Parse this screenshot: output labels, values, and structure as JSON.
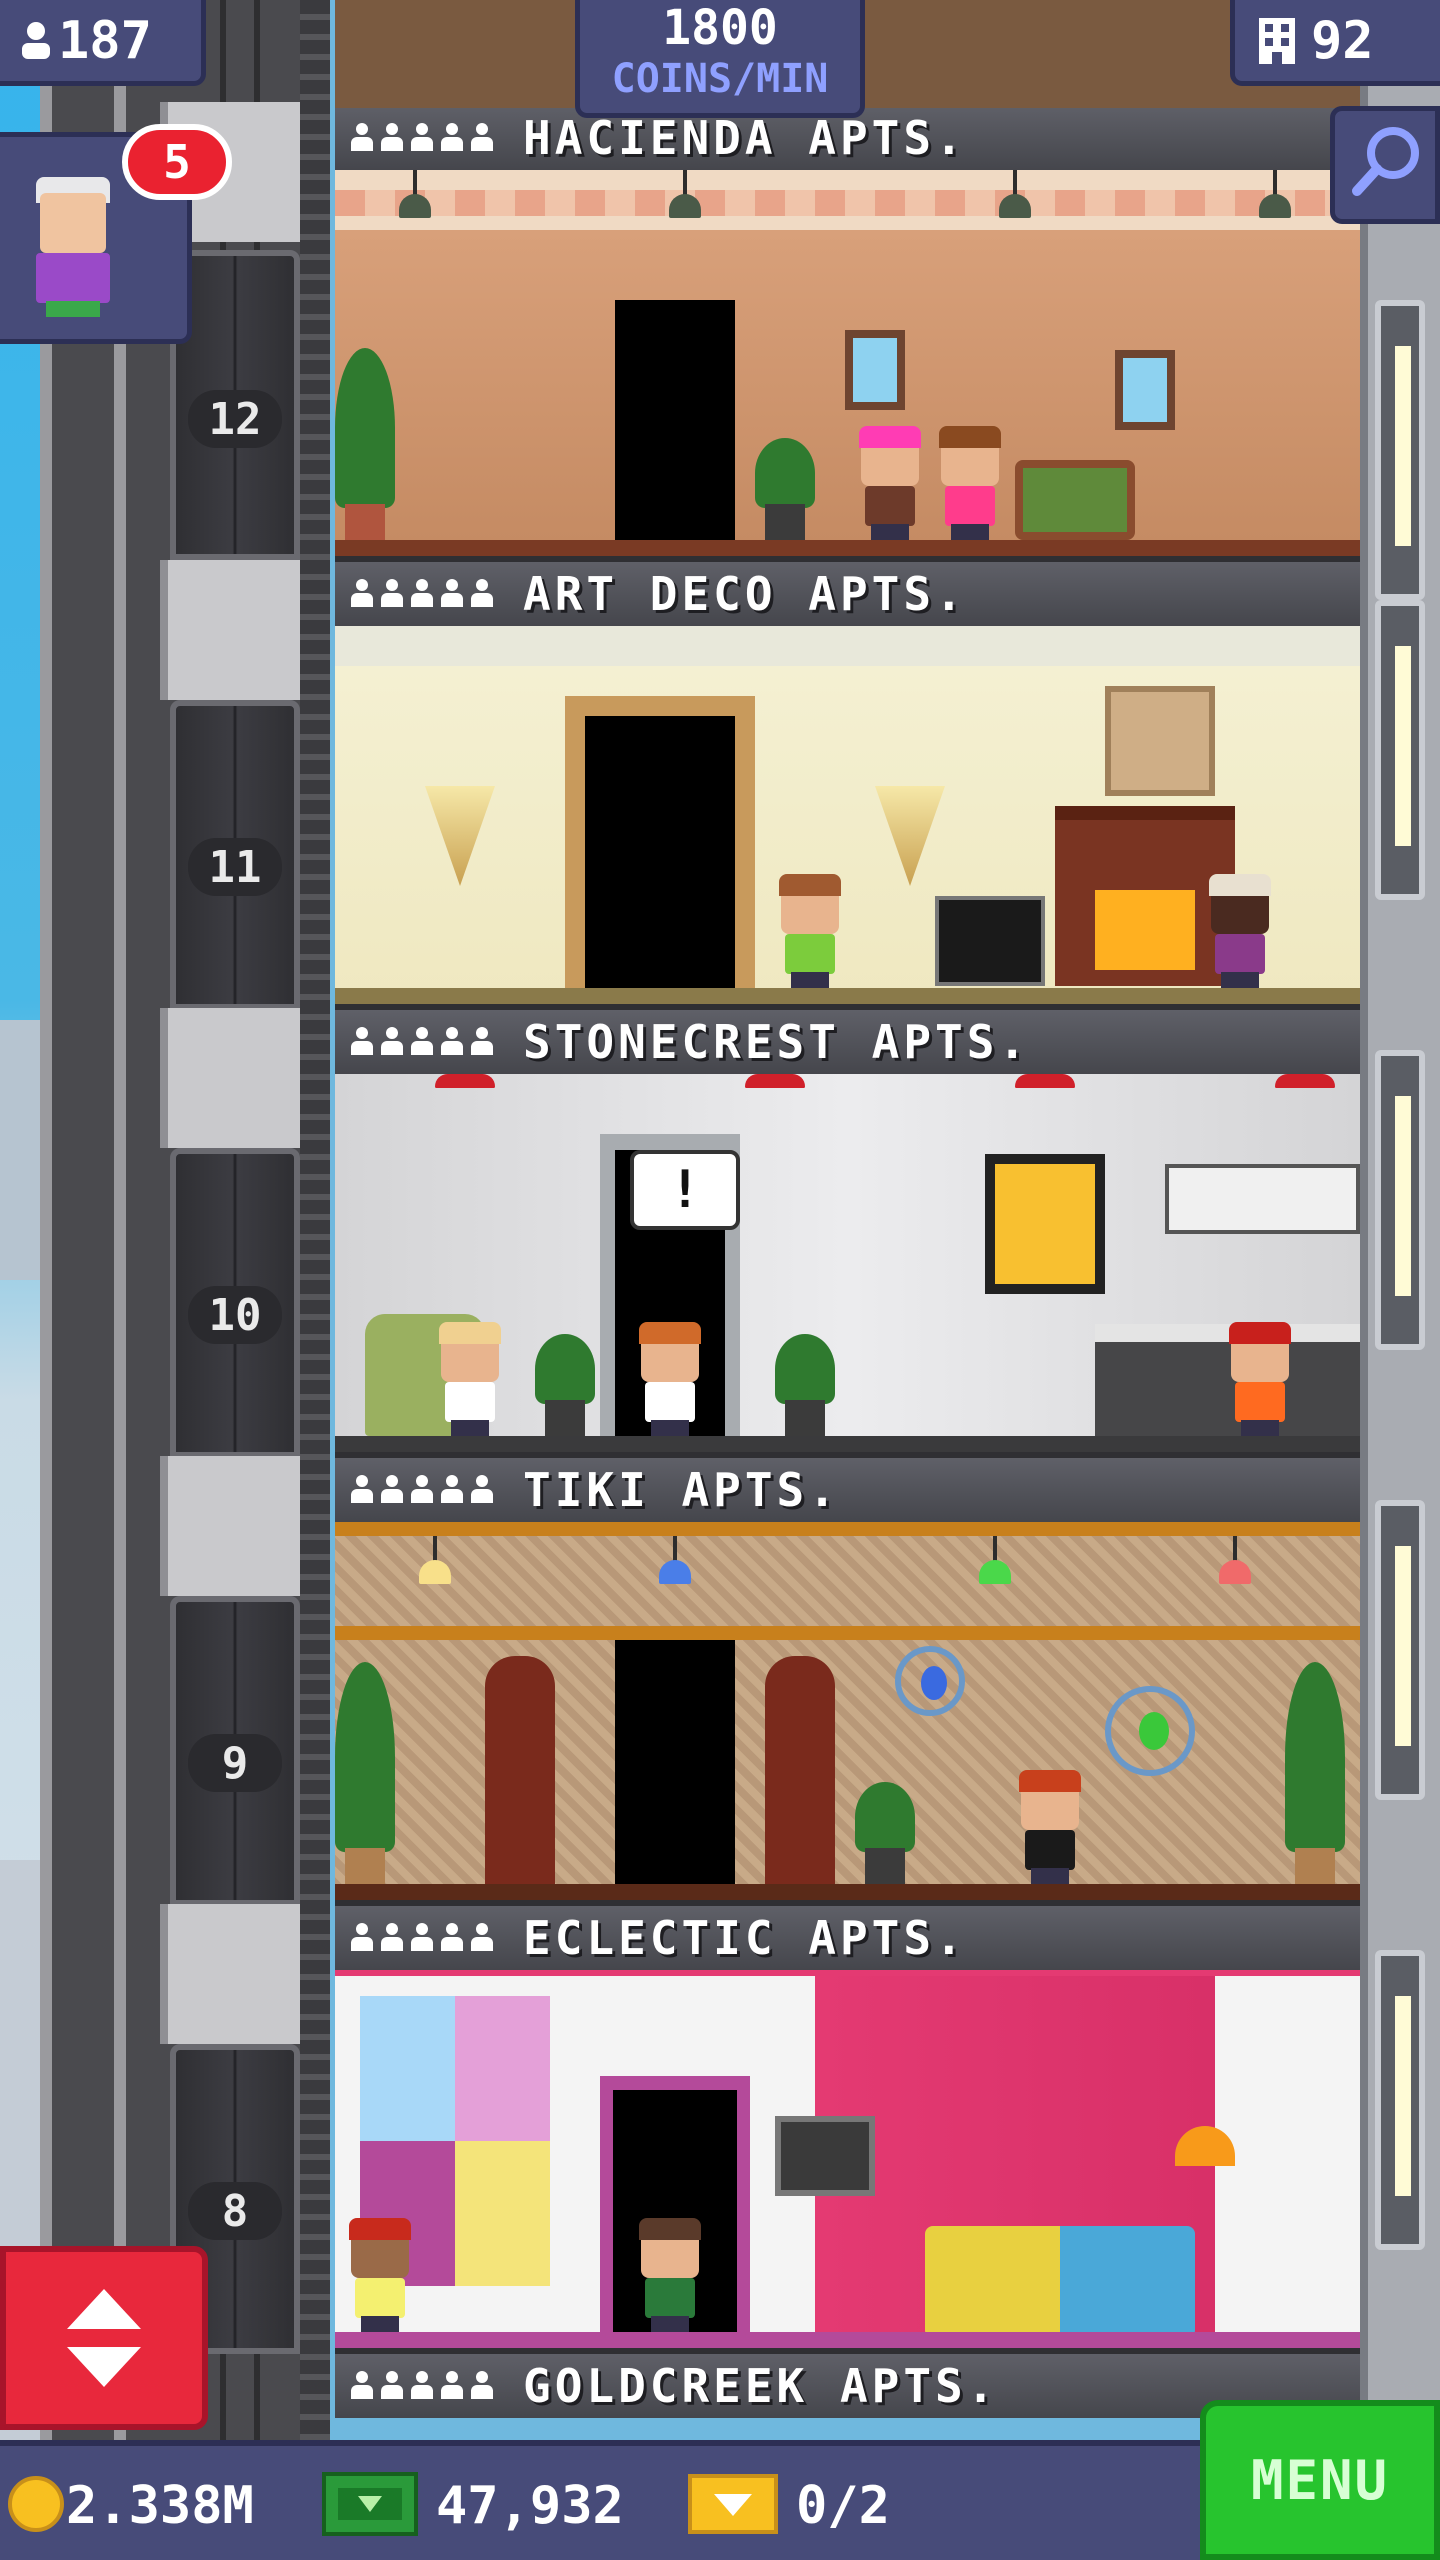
{
  "header": {
    "residents": "187",
    "coins_per_min_value": "1800",
    "coins_per_min_unit": "COINS/MIN",
    "floors_count": "92"
  },
  "notification": {
    "count": "5"
  },
  "elevator_floors": [
    "12",
    "11",
    "10",
    "9",
    "8"
  ],
  "floors": [
    {
      "name": "HACIENDA APTS."
    },
    {
      "name": "ART DECO APTS."
    },
    {
      "name": "STONECREST APTS."
    },
    {
      "name": "TIKI APTS."
    },
    {
      "name": "ECLECTIC APTS."
    },
    {
      "name": "GOLDCREEK APTS."
    }
  ],
  "footer": {
    "coins": "2.338M",
    "bux": "47,932",
    "tickets": "0/2",
    "menu_label": "MENU"
  },
  "colors": {
    "ui_panel": "#474b79",
    "elevator_button": "#e8283c",
    "menu_button": "#27c42e",
    "badge": "#ea2230"
  },
  "icons": [
    "resident-icon",
    "building-icon",
    "search-icon",
    "elevator-arrows-icon",
    "coin-icon",
    "bux-icon",
    "ticket-icon"
  ]
}
